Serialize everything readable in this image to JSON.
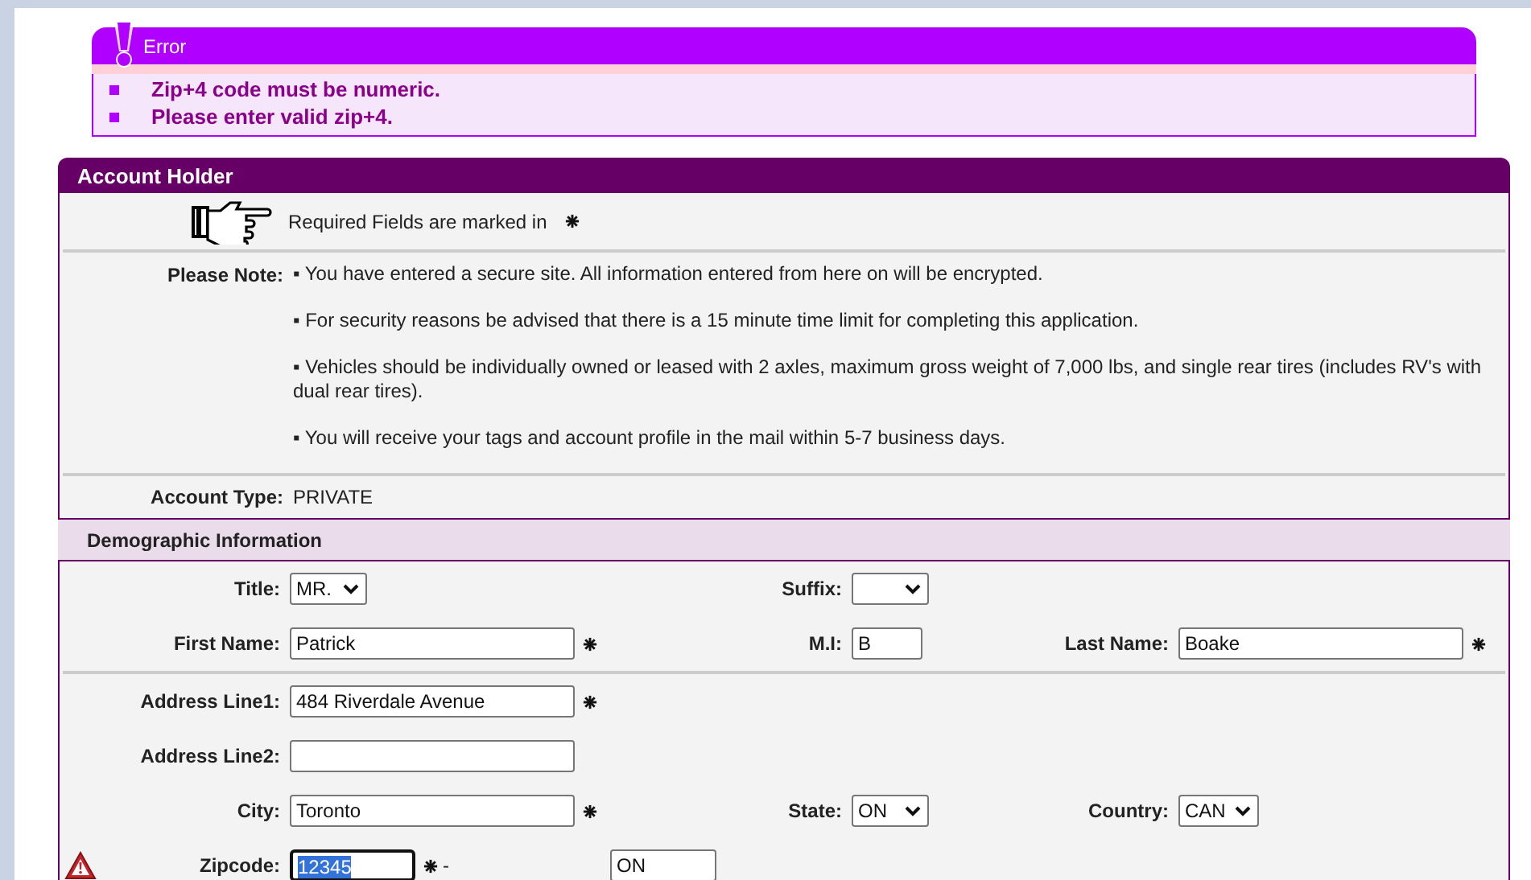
{
  "error": {
    "title": "Error",
    "messages": [
      "Zip+4 code must be numeric.",
      "Please enter valid zip+4."
    ]
  },
  "account_holder": {
    "title": "Account Holder",
    "required_note": "Required Fields are marked in",
    "note_label": "Please Note:",
    "notes": [
      "▪ You have entered a secure site. All information entered from here on will be encrypted.",
      "▪ For security reasons be advised that there is a 15 minute time limit for completing this application.",
      "▪ Vehicles should be individually owned or leased with 2 axles, maximum gross weight of 7,000 lbs, and single rear tires (includes RV's with dual rear tires).",
      "▪ You will receive your tags and account profile in the mail within 5-7 business days."
    ],
    "account_type_label": "Account Type:",
    "account_type": "PRIVATE",
    "section_title": "Demographic Information",
    "rows": [
      {
        "divider_after": false,
        "fields": [
          {
            "label": "Title:",
            "kind": "select",
            "value": "MR.",
            "required": false,
            "error": false
          },
          {
            "label": "Suffix:",
            "kind": "select",
            "required": false,
            "error": false
          }
        ]
      },
      {
        "divider_after": true,
        "fields": [
          {
            "label": "First Name:",
            "kind": "text",
            "value": "Patrick",
            "required": true,
            "error": false
          },
          {
            "label": "M.I:",
            "kind": "initial",
            "value": "B",
            "required": false,
            "error": false
          },
          {
            "label": "Last Name:",
            "kind": "text",
            "value": "Boake",
            "required": true,
            "error": false
          }
        ]
      },
      {
        "divider_after": false,
        "fields": [
          {
            "label": "Address Line1:",
            "kind": "text",
            "value": "484 Riverdale Avenue",
            "required": true,
            "error": false
          }
        ]
      },
      {
        "divider_after": false,
        "fields": [
          {
            "label": "Address Line2:",
            "kind": "text",
            "required": false,
            "error": false
          }
        ]
      },
      {
        "divider_after": false,
        "fields": [
          {
            "label": "City:",
            "kind": "text",
            "value": "Toronto",
            "required": true,
            "error": false
          },
          {
            "label": "State:",
            "kind": "select",
            "value": "ON",
            "required": false,
            "error": false
          },
          {
            "label": "Country:",
            "kind": "select",
            "value": "CAN",
            "required": false,
            "error": false
          }
        ]
      },
      {
        "divider_after": false,
        "fields": [
          {
            "label": "Zipcode:",
            "kind": "zip",
            "value": "12345",
            "value_selected": true,
            "focused": true,
            "required": true,
            "error": true,
            "separator": "-",
            "extension": "ON"
          }
        ]
      }
    ]
  }
}
